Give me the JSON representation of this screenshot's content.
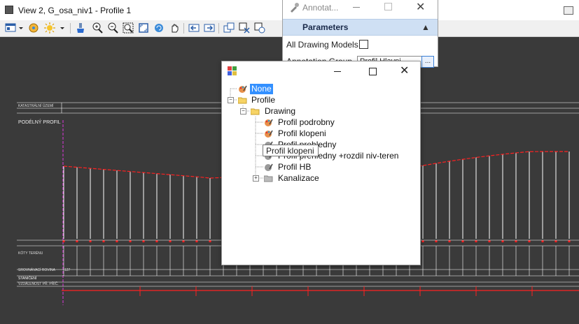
{
  "window": {
    "title": "View 2, G_osa_niv1 - Profile 1"
  },
  "toolbar": {
    "icons": [
      "view-attributes-icon",
      "dropdown-icon",
      "levels-icon",
      "lighting-icon",
      "dropdown-icon",
      "clear-icon",
      "zoom-in-icon",
      "zoom-out-icon",
      "zoom-area-icon",
      "fit-view-icon",
      "rotate-view-icon",
      "pan-icon",
      "previous-view-icon",
      "next-view-icon",
      "copy-view-icon",
      "clip-icon",
      "clip-mask-icon"
    ]
  },
  "profile_canvas": {
    "labels": {
      "katastr": "KATASTRÁLNÍ ÚZEMÍ",
      "podelny": "PODÉLNÝ PROFIL",
      "kety": "KÓTY TERÉNU",
      "srovnavaci": "SROVNÁVACÍ ROVINA",
      "staniceni": "STANIČENÍ",
      "vzdalenost": "VZDÁLENOST  PŘ. PŘÍČ.",
      "datum": "127"
    },
    "colors": {
      "terrain": "#ff2020",
      "grid": "#ffffff",
      "axis": "#d838d8",
      "background": "#3a3a3a"
    }
  },
  "annotation_panel": {
    "title": "Annotat...",
    "section": "Parameters",
    "all_drawing_models_label": "All Drawing Models",
    "annotation_group_label": "Annotation Group",
    "annotation_group_value": "Profil Hlavni",
    "browse_label": "..."
  },
  "tree_dialog": {
    "nodes": {
      "none": "None",
      "profile": "Profile",
      "drawing": "Drawing",
      "podrobny": "Profil podrobny",
      "klopeni": "Profil klopeni",
      "prehledny": "Profil prehledny",
      "prehledny_rozdil": "Profil prehledny +rozdil niv-teren",
      "hb": "Profil HB",
      "kanalizace": "Kanalizace"
    },
    "tooltip": "Profil klopeni"
  }
}
